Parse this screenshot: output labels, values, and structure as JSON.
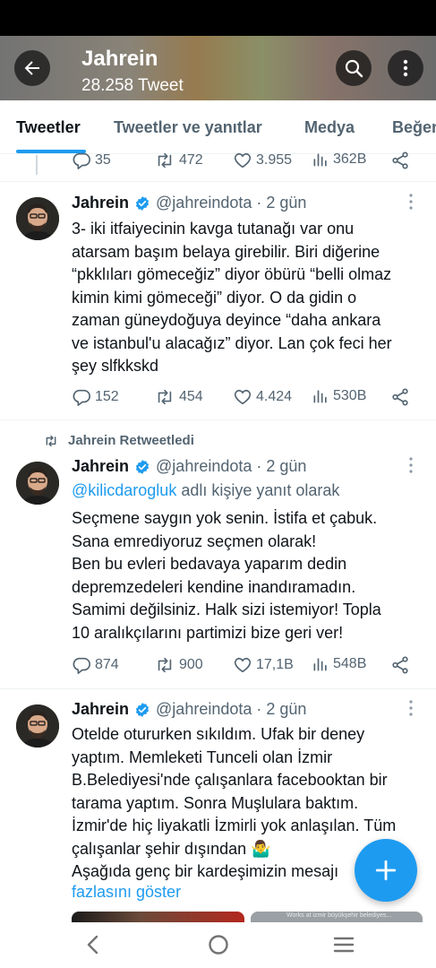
{
  "header": {
    "title": "Jahrein",
    "subtitle": "28.258 Tweet"
  },
  "tabs": [
    {
      "label": "Tweetler",
      "active": true
    },
    {
      "label": "Tweetler ve yanıtlar",
      "active": false
    },
    {
      "label": "Medya",
      "active": false
    },
    {
      "label": "Beğen",
      "active": false
    }
  ],
  "prev_tweet_stats": {
    "replies": "35",
    "retweets": "472",
    "likes": "3.955",
    "views": "362B"
  },
  "tweets": [
    {
      "name": "Jahrein",
      "handle": "@jahreindota · 2 gün",
      "text": "3- iki itfaiyecinin kavga tutanağı var onu\natarsam başım belaya girebilir. Biri diğerine\n“pkklıları gömeceğiz” diyor öbürü “belli olmaz\nkimin kimi gömeceği” diyor. O da gidin o\nzaman güneydoğuya deyince “daha ankara\nve istanbul'u alacağız” diyor. Lan çok feci her\nşey slfkkskd",
      "replies": "152",
      "retweets": "454",
      "likes": "4.424",
      "views": "530B"
    },
    {
      "retweet_label": "Jahrein Retweetledi",
      "name": "Jahrein",
      "handle": "@jahreindota · 2 gün",
      "reply_mention": "@kilicdarogluk",
      "reply_suffix": "adlı kişiye yanıt olarak",
      "text": "Seçmene saygın yok senin. İstifa et çabuk.\nSana emrediyoruz seçmen olarak!\nBen bu evleri bedavaya yaparım dedin\ndepremzedeleri kendine inandıramadın.\nSamimi değilsiniz. Halk sizi istemiyor! Topla\n10 aralıkçılarını partimizi bize geri ver!",
      "replies": "874",
      "retweets": "900",
      "likes": "17,1B",
      "views": "548B"
    },
    {
      "name": "Jahrein",
      "handle": "@jahreindota · 2 gün",
      "text": "Otelde otururken sıkıldım. Ufak bir deney\nyaptım. Memleketi Tunceli olan İzmir\nB.Belediyesi'nde çalışanlara facebooktan bir\ntarama yaptım. Sonra Muşlulara baktım.\nİzmir'de hiç liyakatli İzmirli yok anlaşılan. Tüm\nçalışanlar şehir dışından 🤷‍♂️\nAşağıda genç bir kardeşimizin mesajı",
      "show_more": "fazlasını göster",
      "media_caption": "Works at izmir büyükşehir belediyes..."
    }
  ],
  "colors": {
    "accent": "#1d9bf0",
    "muted": "#536471",
    "text": "#0f1419"
  }
}
